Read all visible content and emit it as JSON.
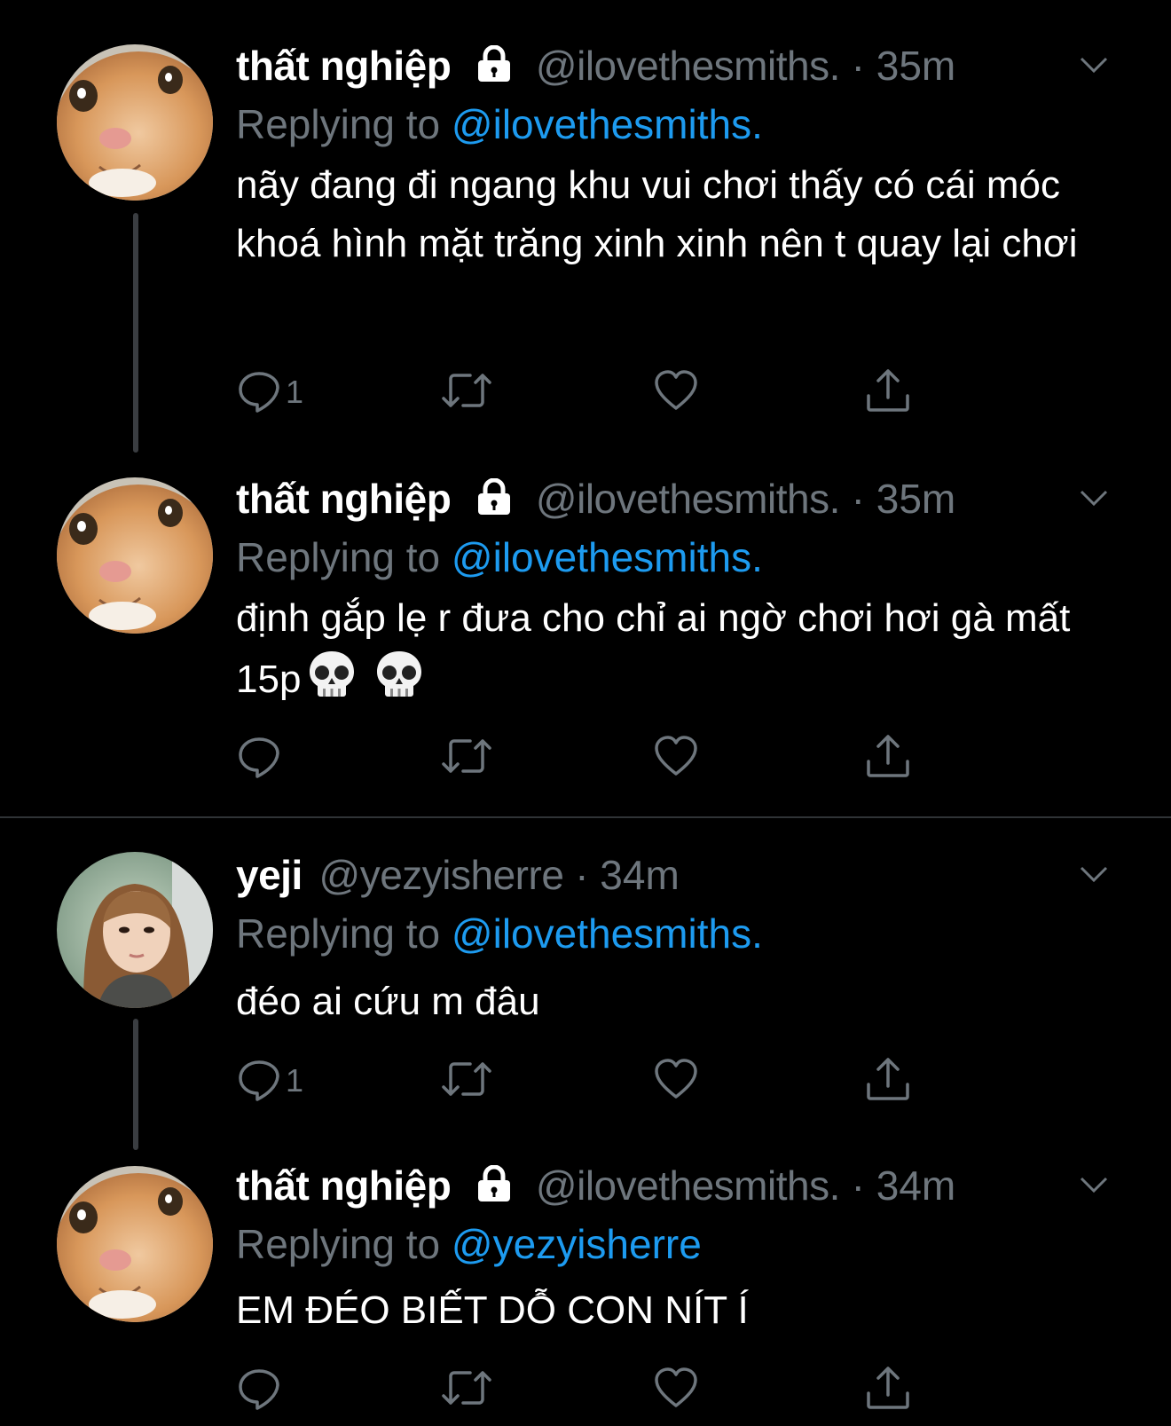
{
  "tweets": [
    {
      "name": "thất nghiệp",
      "handle": "@ilovethesmiths.",
      "dot": "·",
      "time": "35m",
      "replying_prefix": "Replying to",
      "replying_to": "@ilovethesmiths.",
      "text": "nãy đang đi ngang khu vui chơi thấy có cái móc khoá hình mặt trăng xinh xinh nên t quay lại chơi",
      "reply_count": "1",
      "locked": true
    },
    {
      "name": "thất nghiệp",
      "handle": "@ilovethesmiths.",
      "dot": "·",
      "time": "35m",
      "replying_prefix": "Replying to",
      "replying_to": "@ilovethesmiths.",
      "text": "định gắp lẹ r đưa cho chỉ ai ngờ chơi hơi gà mất 15p",
      "reply_count": "",
      "locked": true
    },
    {
      "name": "yeji",
      "handle": "@yezyisherre",
      "dot": "·",
      "time": "34m",
      "replying_prefix": "Replying to",
      "replying_to": "@ilovethesmiths.",
      "text": "đéo ai cứu m đâu",
      "reply_count": "1",
      "locked": false
    },
    {
      "name": "thất nghiệp",
      "handle": "@ilovethesmiths.",
      "dot": "·",
      "time": "34m",
      "replying_prefix": "Replying to",
      "replying_to": "@yezyisherre",
      "text": "EM ĐÉO BIẾT DỖ CON NÍT Í",
      "reply_count": "",
      "locked": true
    }
  ],
  "icons": {
    "lock": "lock-icon",
    "caret": "chevron-down-icon",
    "reply": "reply-icon",
    "retweet": "retweet-icon",
    "like": "heart-icon",
    "share": "share-icon",
    "emoji": "skull-emoji"
  },
  "colors": {
    "background": "#000000",
    "text": "#ffffff",
    "muted": "#6e767d",
    "link": "#1d9bf0",
    "thread_line": "#3a3d41",
    "separator": "#2f3336"
  }
}
